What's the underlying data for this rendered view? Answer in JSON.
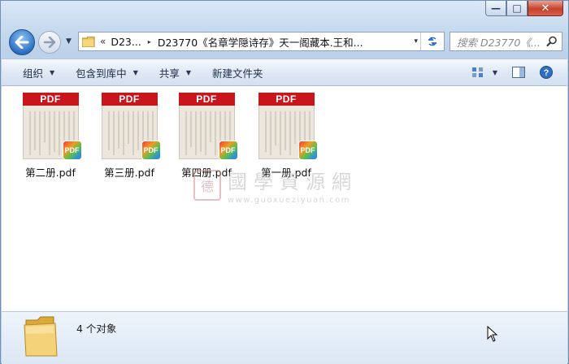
{
  "window": {
    "caption_buttons": [
      {
        "name": "minimize",
        "glyph": "—"
      },
      {
        "name": "maximize",
        "glyph": "□"
      },
      {
        "name": "close",
        "glyph": "✕"
      }
    ]
  },
  "address_bar": {
    "overflow_chevron": "«",
    "crumbs": [
      "D23...",
      "D23770《名章学隠诗存》天一阁藏本.王和..."
    ],
    "separator": "▸",
    "dropdown": "▾"
  },
  "search": {
    "placeholder": "搜索 D23770《..."
  },
  "toolbar": {
    "items": [
      {
        "label": "组织",
        "has_dropdown": true
      },
      {
        "label": "包含到库中",
        "has_dropdown": true
      },
      {
        "label": "共享",
        "has_dropdown": true
      },
      {
        "label": "新建文件夹",
        "has_dropdown": false
      }
    ],
    "dropdown_arrow": "▼"
  },
  "files": [
    {
      "name": "第二册.pdf",
      "band": "PDF",
      "badge": "PDF"
    },
    {
      "name": "第三册.pdf",
      "band": "PDF",
      "badge": "PDF"
    },
    {
      "name": "第四册.pdf",
      "band": "PDF",
      "badge": "PDF"
    },
    {
      "name": "第一册.pdf",
      "band": "PDF",
      "badge": "PDF"
    }
  ],
  "watermark": {
    "title": "國學資源網",
    "url": "www.guoxueziyuan.com",
    "seal": "德"
  },
  "details": {
    "count_text": "4 个对象"
  },
  "colors": {
    "pdf_red": "#c9151c",
    "chrome_blue": "#c7daee"
  }
}
